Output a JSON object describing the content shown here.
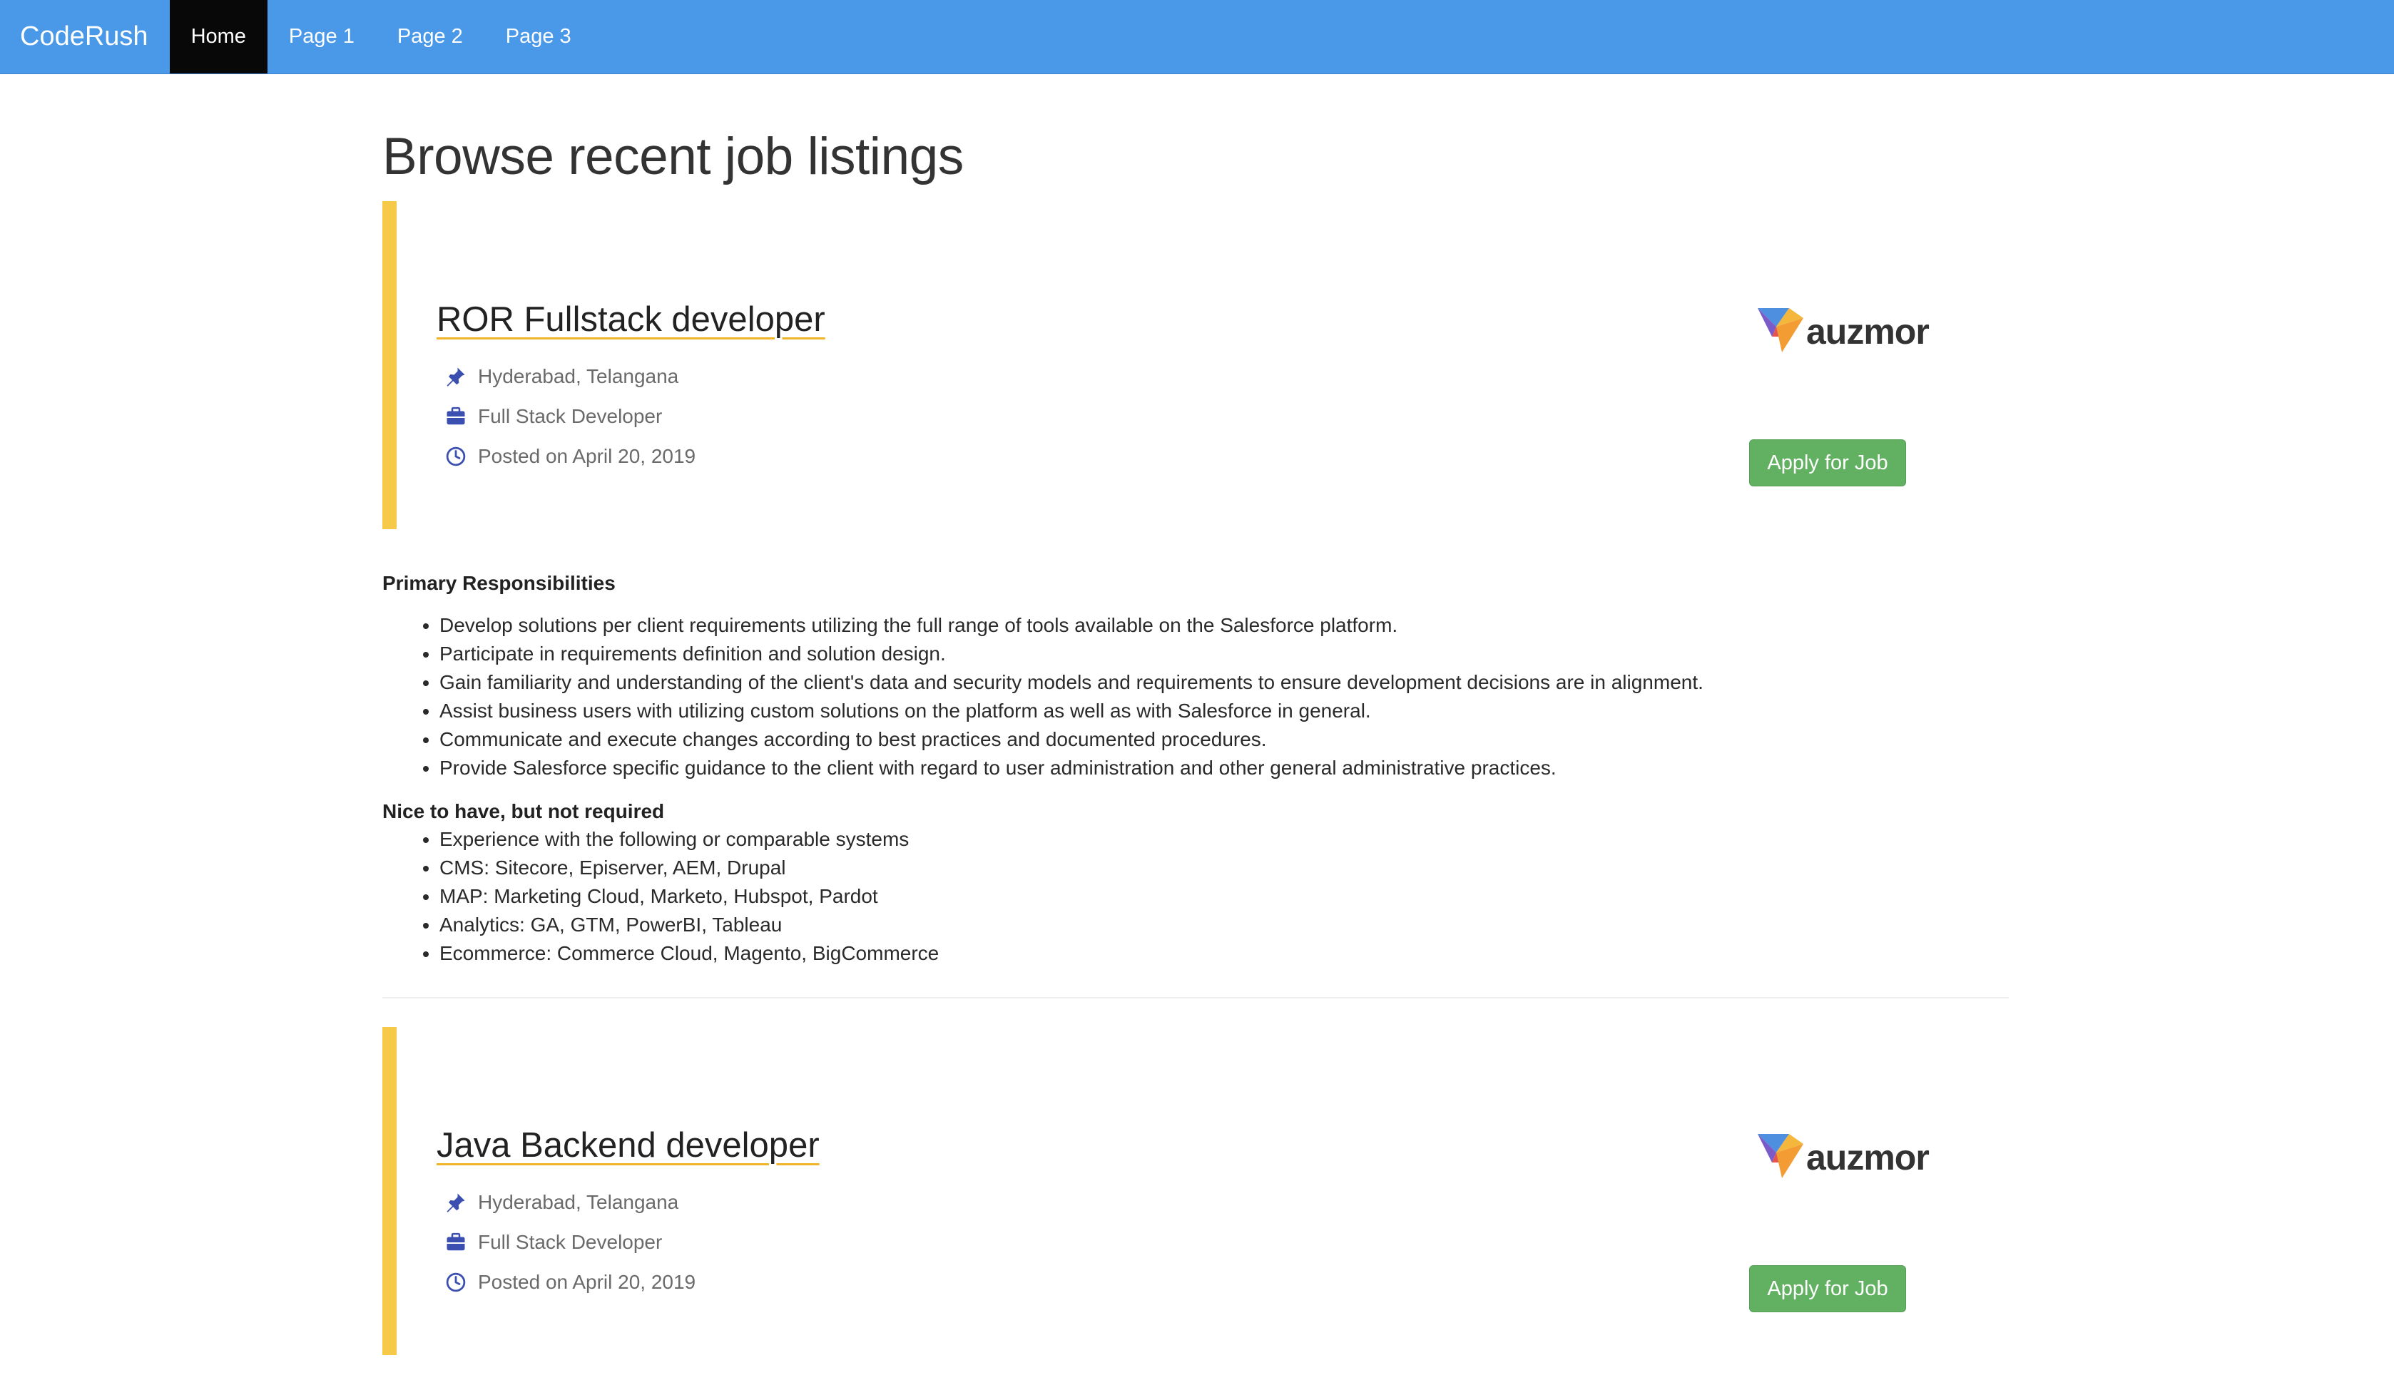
{
  "navbar": {
    "brand": "CodeRush",
    "items": [
      {
        "label": "Home",
        "active": true
      },
      {
        "label": "Page 1",
        "active": false
      },
      {
        "label": "Page 2",
        "active": false
      },
      {
        "label": "Page 3",
        "active": false
      }
    ]
  },
  "page": {
    "title": "Browse recent job listings"
  },
  "jobs": [
    {
      "title": "ROR Fullstack developer",
      "location": "Hyderabad, Telangana",
      "category": "Full Stack Developer",
      "posted": "Posted on April 20, 2019",
      "company_logo_text": "auzmor",
      "apply_label": "Apply for Job"
    },
    {
      "title": "Java Backend developer",
      "location": "Hyderabad, Telangana",
      "category": "Full Stack Developer",
      "posted": "Posted on April 20, 2019",
      "company_logo_text": "auzmor",
      "apply_label": "Apply for Job"
    }
  ],
  "description": {
    "primary_heading": "Primary Responsibilities",
    "primary_items": [
      "Develop solutions per client requirements utilizing the full range of tools available on the Salesforce platform.",
      "Participate in requirements definition and solution design.",
      "Gain familiarity and understanding of the client's data and security models and requirements to ensure development decisions are in alignment.",
      "Assist business users with utilizing custom solutions on the platform as well as with Salesforce in general.",
      "Communicate and execute changes according to best practices and documented procedures.",
      "Provide Salesforce specific guidance to the client with regard to user administration and other general administrative practices."
    ],
    "nice_heading": "Nice to have, but not required",
    "nice_items": [
      "Experience with the following or comparable systems",
      "CMS: Sitecore, Episerver, AEM, Drupal",
      "MAP: Marketing Cloud, Marketo, Hubspot, Pardot",
      "Analytics: GA, GTM, PowerBI, Tableau",
      "Ecommerce: Commerce Cloud, Magento, BigCommerce"
    ]
  },
  "colors": {
    "navbar": "#4a98e8",
    "nav_active": "#080808",
    "accent_bar": "#f7c948",
    "apply_button": "#62b162",
    "meta_icon": "#3b4fb0"
  },
  "icons": {
    "location": "pushpin-icon",
    "category": "briefcase-icon",
    "posted": "clock-icon"
  }
}
